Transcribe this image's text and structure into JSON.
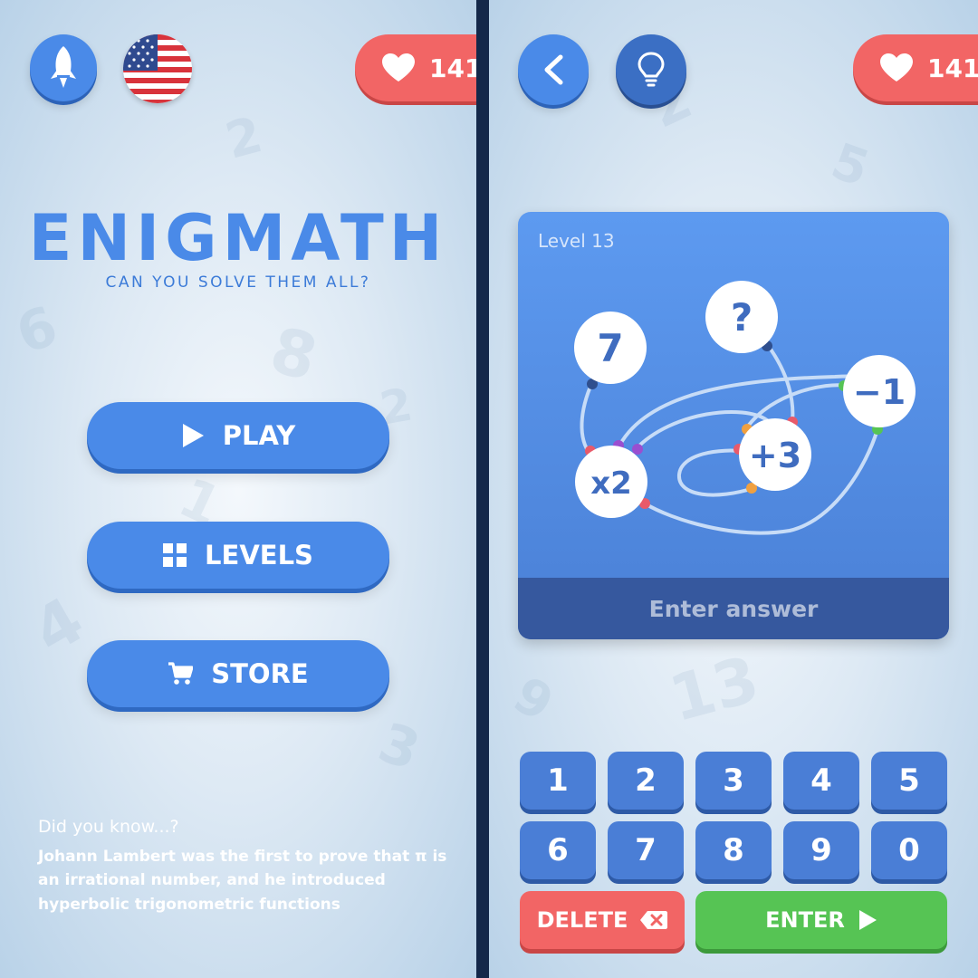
{
  "left_screen": {
    "lives": "141",
    "title": "ENIGMATH",
    "subtitle": "CAN YOU SOLVE THEM ALL?",
    "menu": {
      "play_label": "PLAY",
      "levels_label": "LEVELS",
      "store_label": "STORE"
    },
    "fact": {
      "heading": "Did you know...?",
      "text": "Johann Lambert was the first to prove that π is an irrational number, and he introduced hyperbolic trigonometric functions"
    },
    "icons": [
      "rocket-icon",
      "us-flag-icon",
      "heart-icon",
      "play-icon",
      "grid-icon",
      "cart-icon"
    ]
  },
  "right_screen": {
    "lives": "141",
    "level_label": "Level 13",
    "nodes": {
      "seven": "7",
      "question": "?",
      "minus_one": "−1",
      "times_two": "x2",
      "plus_three": "+3"
    },
    "answer_placeholder": "Enter answer",
    "keypad": {
      "row1": [
        "1",
        "2",
        "3",
        "4",
        "5"
      ],
      "row2": [
        "6",
        "7",
        "8",
        "9",
        "0"
      ]
    },
    "delete_label": "DELETE",
    "enter_label": "ENTER",
    "icons": [
      "back-arrow-icon",
      "lightbulb-icon",
      "heart-icon",
      "backspace-icon",
      "play-icon"
    ]
  },
  "colors": {
    "accent_blue": "#4a8ae8",
    "lives_red": "#f26565",
    "enter_green": "#56c454",
    "answer_bar": "#36589e"
  }
}
